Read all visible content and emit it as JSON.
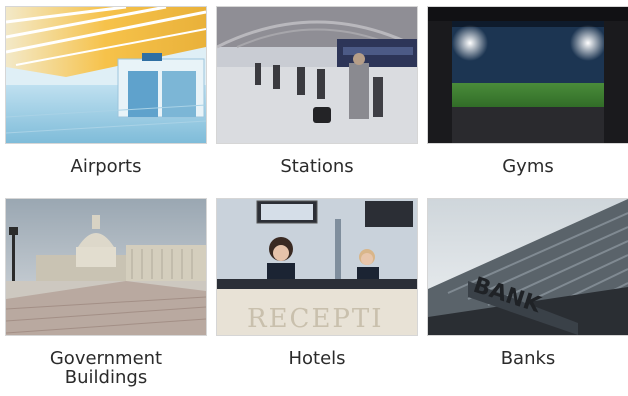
{
  "tiles": [
    {
      "label": "Airports",
      "image": "airport-terminal-photo"
    },
    {
      "label": "Stations",
      "image": "train-station-photo"
    },
    {
      "label": "Gyms",
      "image": "stadium-tunnel-photo"
    },
    {
      "label": "Government\nBuildings",
      "image": "capitol-building-photo"
    },
    {
      "label": "Hotels",
      "image": "hotel-reception-photo"
    },
    {
      "label": "Banks",
      "image": "bank-building-photo"
    }
  ],
  "photo_text": {
    "bank_sign": "BANK",
    "reception_sign": "RECEPTI"
  }
}
